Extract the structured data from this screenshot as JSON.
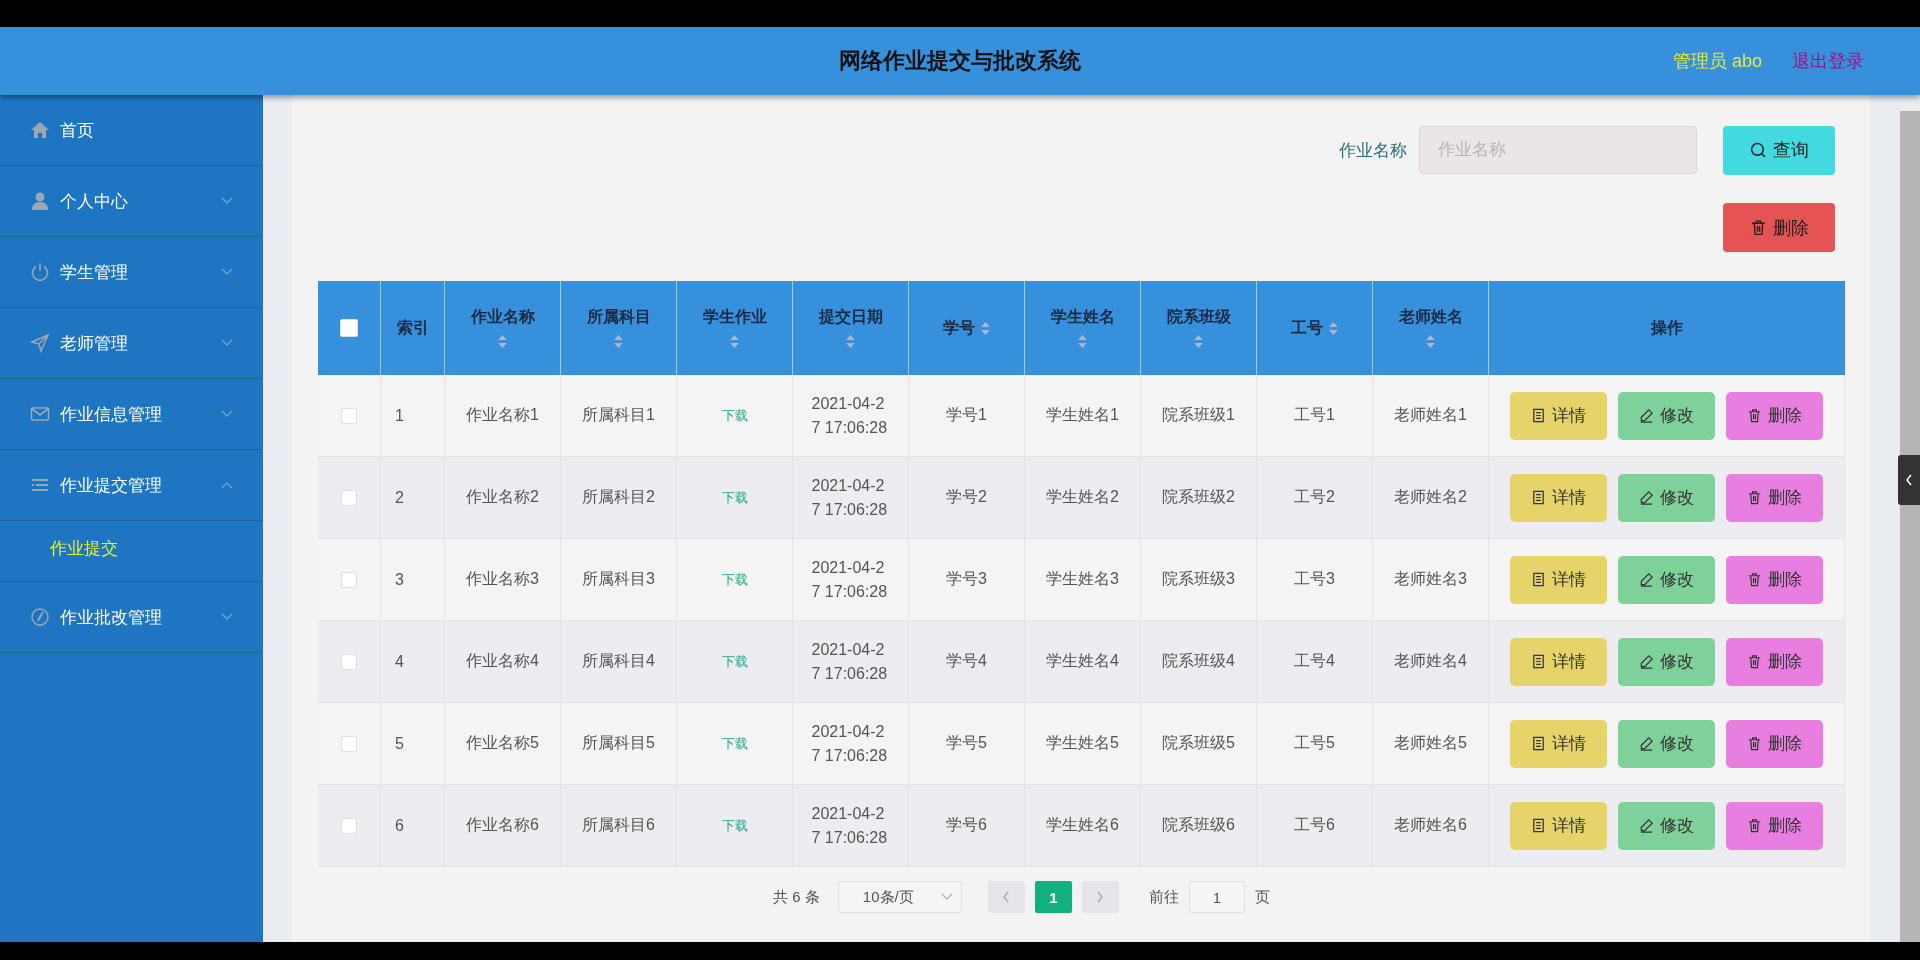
{
  "header": {
    "title": "网络作业提交与批改系统",
    "user": "管理员 abo",
    "logout": "退出登录"
  },
  "sidebar": {
    "items": [
      {
        "label": "首页"
      },
      {
        "label": "个人中心",
        "expanded": false
      },
      {
        "label": "学生管理",
        "expanded": false
      },
      {
        "label": "老师管理",
        "expanded": false
      },
      {
        "label": "作业信息管理",
        "expanded": false
      },
      {
        "label": "作业提交管理",
        "expanded": true,
        "children": [
          {
            "label": "作业提交",
            "selected": true
          }
        ]
      },
      {
        "label": "作业批改管理",
        "expanded": false
      }
    ]
  },
  "search": {
    "label": "作业名称",
    "placeholder": "作业名称",
    "button": "查询"
  },
  "delete_button": "删除",
  "table": {
    "select_all": {
      "checked": false
    },
    "columns": [
      {
        "label": "索引",
        "sortable": false
      },
      {
        "label": "作业名称",
        "sortable": true
      },
      {
        "label": "所属科目",
        "sortable": true
      },
      {
        "label": "学生作业",
        "sortable": true
      },
      {
        "label": "提交日期",
        "sortable": true
      },
      {
        "label": "学号",
        "sortable": true
      },
      {
        "label": "学生姓名",
        "sortable": true
      },
      {
        "label": "院系班级",
        "sortable": true
      },
      {
        "label": "工号",
        "sortable": true
      },
      {
        "label": "老师姓名",
        "sortable": true
      },
      {
        "label": "操作",
        "sortable": false
      }
    ],
    "rows": [
      {
        "checked": false,
        "cells": [
          "1",
          "作业名称1",
          "所属科目1",
          "下载",
          "2021-04-27 17:06:28",
          "学号1",
          "学生姓名1",
          "院系班级1",
          "工号1",
          "老师姓名1"
        ],
        "actions": [
          {
            "label": "详情",
            "kind": "detail"
          },
          {
            "label": "修改",
            "kind": "edit"
          },
          {
            "label": "删除",
            "kind": "delete"
          }
        ]
      },
      {
        "checked": false,
        "cells": [
          "2",
          "作业名称2",
          "所属科目2",
          "下载",
          "2021-04-27 17:06:28",
          "学号2",
          "学生姓名2",
          "院系班级2",
          "工号2",
          "老师姓名2"
        ],
        "actions": [
          {
            "label": "详情",
            "kind": "detail"
          },
          {
            "label": "修改",
            "kind": "edit"
          },
          {
            "label": "删除",
            "kind": "delete"
          }
        ]
      },
      {
        "checked": false,
        "cells": [
          "3",
          "作业名称3",
          "所属科目3",
          "下载",
          "2021-04-27 17:06:28",
          "学号3",
          "学生姓名3",
          "院系班级3",
          "工号3",
          "老师姓名3"
        ],
        "actions": [
          {
            "label": "详情",
            "kind": "detail"
          },
          {
            "label": "修改",
            "kind": "edit"
          },
          {
            "label": "删除",
            "kind": "delete"
          }
        ]
      },
      {
        "checked": false,
        "cells": [
          "4",
          "作业名称4",
          "所属科目4",
          "下载",
          "2021-04-27 17:06:28",
          "学号4",
          "学生姓名4",
          "院系班级4",
          "工号4",
          "老师姓名4"
        ],
        "actions": [
          {
            "label": "详情",
            "kind": "detail"
          },
          {
            "label": "修改",
            "kind": "edit"
          },
          {
            "label": "删除",
            "kind": "delete"
          }
        ]
      },
      {
        "checked": false,
        "cells": [
          "5",
          "作业名称5",
          "所属科目5",
          "下载",
          "2021-04-27 17:06:28",
          "学号5",
          "学生姓名5",
          "院系班级5",
          "工号5",
          "老师姓名5"
        ],
        "actions": [
          {
            "label": "详情",
            "kind": "detail"
          },
          {
            "label": "修改",
            "kind": "edit"
          },
          {
            "label": "删除",
            "kind": "delete"
          }
        ]
      },
      {
        "checked": false,
        "cells": [
          "6",
          "作业名称6",
          "所属科目6",
          "下载",
          "2021-04-27 17:06:28",
          "学号6",
          "学生姓名6",
          "院系班级6",
          "工号6",
          "老师姓名6"
        ],
        "actions": [
          {
            "label": "详情",
            "kind": "detail"
          },
          {
            "label": "修改",
            "kind": "edit"
          },
          {
            "label": "删除",
            "kind": "delete"
          }
        ]
      }
    ]
  },
  "pagination": {
    "total": "共 6 条",
    "page_size": "10条/页",
    "pages": [
      {
        "label": "1",
        "selected": true
      }
    ],
    "goto_label": "前往",
    "goto_value": "1",
    "goto_suffix": "页"
  }
}
